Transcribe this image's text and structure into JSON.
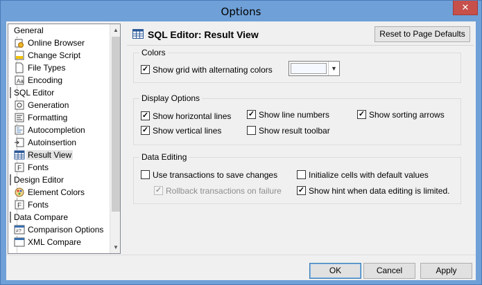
{
  "window": {
    "title": "Options",
    "close_glyph": "✕"
  },
  "tree": {
    "items": [
      {
        "label": "General",
        "type": "category",
        "icon": ""
      },
      {
        "label": "Online Browser",
        "type": "item",
        "icon": "browser-icon"
      },
      {
        "label": "Change Script",
        "type": "item",
        "icon": "script-icon"
      },
      {
        "label": "File Types",
        "type": "item",
        "icon": "file-icon"
      },
      {
        "label": "Encoding",
        "type": "item",
        "icon": "encoding-icon"
      },
      {
        "label": "SQL Editor",
        "type": "category",
        "icon": ""
      },
      {
        "label": "Generation",
        "type": "item",
        "icon": "generation-icon"
      },
      {
        "label": "Formatting",
        "type": "item",
        "icon": "formatting-icon"
      },
      {
        "label": "Autocompletion",
        "type": "item",
        "icon": "autocompletion-icon"
      },
      {
        "label": "Autoinsertion",
        "type": "item",
        "icon": "autoinsertion-icon"
      },
      {
        "label": "Result View",
        "type": "item",
        "icon": "grid-icon",
        "selected": true
      },
      {
        "label": "Fonts",
        "type": "item",
        "icon": "font-icon"
      },
      {
        "label": "Design Editor",
        "type": "category",
        "icon": ""
      },
      {
        "label": "Element Colors",
        "type": "item",
        "icon": "palette-icon"
      },
      {
        "label": "Fonts",
        "type": "item",
        "icon": "font-icon"
      },
      {
        "label": "Data Compare",
        "type": "category",
        "icon": ""
      },
      {
        "label": "Comparison Options",
        "type": "item",
        "icon": "compare-icon"
      },
      {
        "label": "XML Compare",
        "type": "item",
        "icon": "xml-icon"
      }
    ]
  },
  "pane": {
    "title": "SQL Editor: Result View",
    "reset_label": "Reset to Page Defaults"
  },
  "colors_group": {
    "label": "Colors",
    "alt_colors": {
      "label": "Show grid with alternating colors",
      "checked": true
    },
    "color_value": "#f5f8ff"
  },
  "display_group": {
    "label": "Display Options",
    "options": [
      {
        "label": "Show horizontal lines",
        "checked": true
      },
      {
        "label": "Show line numbers",
        "checked": true
      },
      {
        "label": "Show sorting arrows",
        "checked": true
      },
      {
        "label": "Show vertical lines",
        "checked": true
      },
      {
        "label": "Show result toolbar",
        "checked": false
      }
    ]
  },
  "editing_group": {
    "label": "Data Editing",
    "options": [
      {
        "label": "Use transactions to save changes",
        "checked": false,
        "disabled": false
      },
      {
        "label": "Initialize cells with default values",
        "checked": false,
        "disabled": false
      },
      {
        "label": "Rollback transactions on failure",
        "checked": true,
        "disabled": true
      },
      {
        "label": "Show hint when data editing  is limited.",
        "checked": true,
        "disabled": false
      }
    ]
  },
  "buttons": {
    "ok": "OK",
    "cancel": "Cancel",
    "apply": "Apply"
  }
}
